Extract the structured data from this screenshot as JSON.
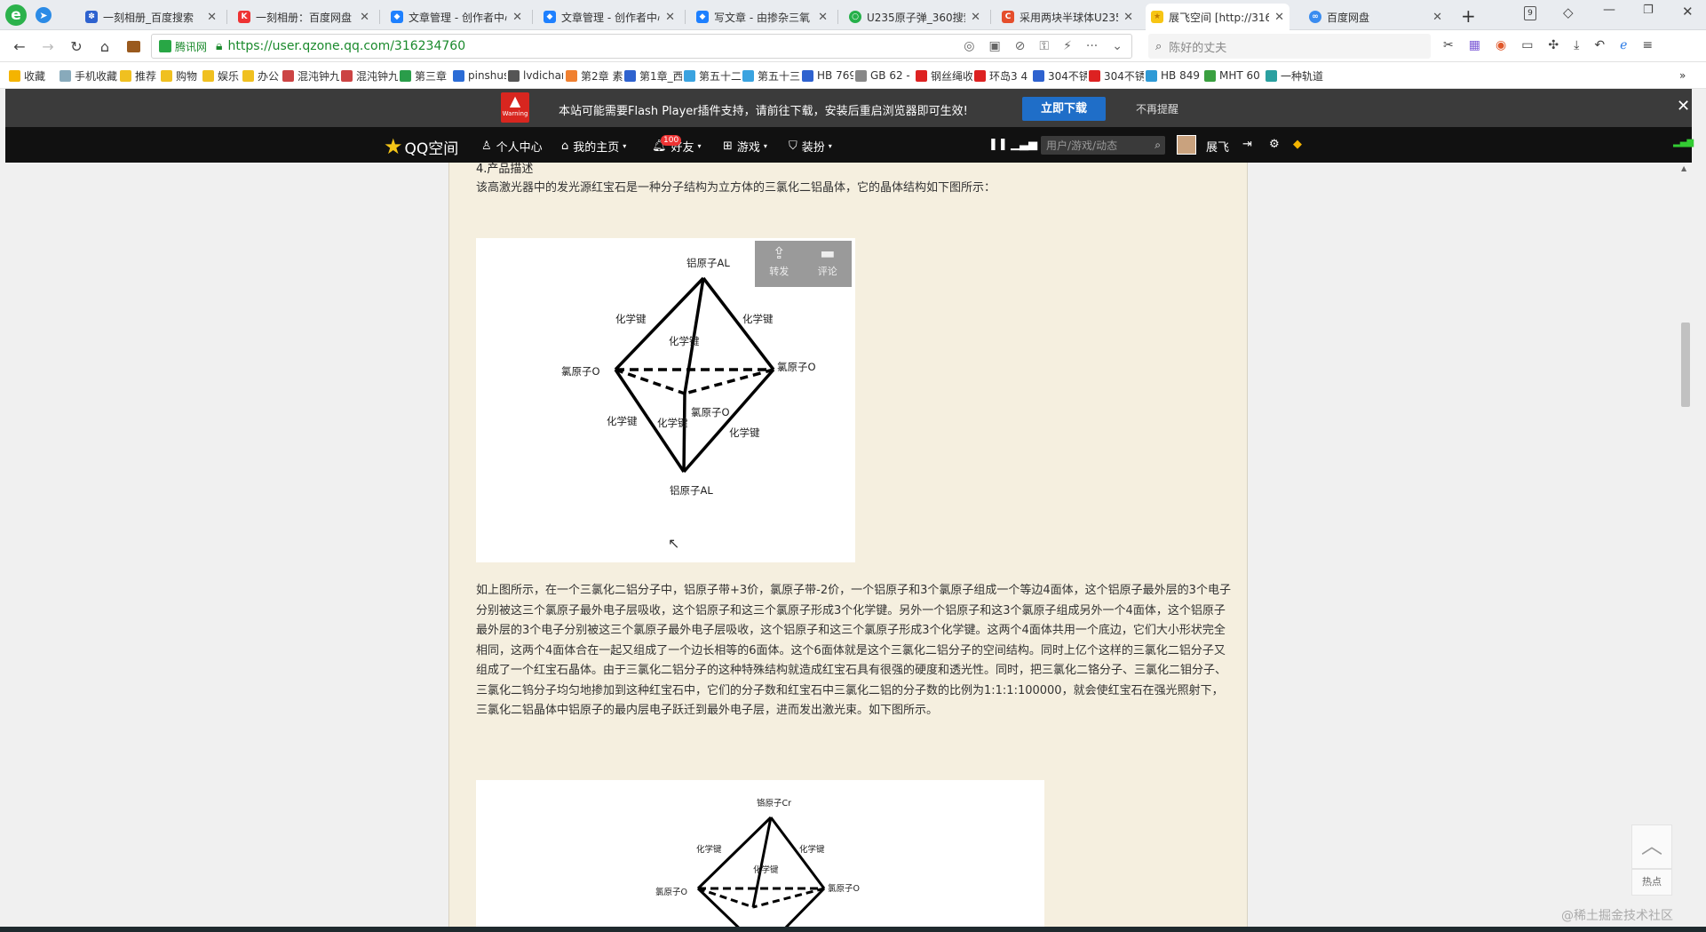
{
  "browser": {
    "tabs": [
      {
        "title": "一刻相册_百度搜索"
      },
      {
        "title": "一刻相册：百度网盘"
      },
      {
        "title": "文章管理 - 创作者中心"
      },
      {
        "title": "文章管理 - 创作者中心"
      },
      {
        "title": "写文章 - 由掺杂三氧"
      },
      {
        "title": "U235原子弹_360搜索"
      },
      {
        "title": "采用两块半球体U235"
      },
      {
        "title": "展飞空间 [http://316"
      },
      {
        "title": "百度网盘"
      }
    ],
    "tab_count": "9",
    "address": {
      "security_label": "腾讯网",
      "url": "https://user.qzone.qq.com/316234760"
    },
    "search_placeholder": "陈好的丈夫",
    "bookmarks": [
      {
        "label": "收藏"
      },
      {
        "label": "手机收藏夹"
      },
      {
        "label": "推荐"
      },
      {
        "label": "购物"
      },
      {
        "label": "娱乐"
      },
      {
        "label": "办公"
      },
      {
        "label": "混沌钟九"
      },
      {
        "label": "混沌钟九"
      },
      {
        "label": "第三章"
      },
      {
        "label": "pinshus"
      },
      {
        "label": "lvdichar"
      },
      {
        "label": "第2章 素"
      },
      {
        "label": "第1章_西"
      },
      {
        "label": "第五十二"
      },
      {
        "label": "第五十三"
      },
      {
        "label": "HB 769"
      },
      {
        "label": "GB 62 -"
      },
      {
        "label": "钢丝绳收"
      },
      {
        "label": "环岛3 4"
      },
      {
        "label": "304不锈"
      },
      {
        "label": "304不锈"
      },
      {
        "label": "HB 849"
      },
      {
        "label": "MHT 60"
      },
      {
        "label": "一种轨道"
      }
    ]
  },
  "flash_notice": {
    "warning_label": "Warning",
    "message": "本站可能需要Flash Player插件支持，请前往下载，安装后重启浏览器即可生效!",
    "download_button": "立即下载",
    "dismiss_link": "不再提醒"
  },
  "qzone_nav": {
    "logo_text": "QQ空间",
    "items": [
      {
        "label": "个人中心"
      },
      {
        "label": "我的主页"
      },
      {
        "label": "好友"
      },
      {
        "label": "游戏"
      },
      {
        "label": "装扮"
      }
    ],
    "friend_badge": "100",
    "search_placeholder": "用户/游戏/动态",
    "user_name": "展飞"
  },
  "article": {
    "section_heading": "4.产品描述",
    "intro": "该高激光器中的发光源红宝石是一种分子结构为立方体的三氯化二铝晶体，它的晶体结构如下图所示：",
    "image_actions": {
      "share": "转发",
      "comment": "评论"
    },
    "diagram1": {
      "top_atom": "铝原子AL",
      "bottom_atom": "铝原子AL",
      "left_atom": "氯原子O",
      "right_atom": "氯原子O",
      "middle_atom": "氯原子O",
      "bond_labels": [
        "化学键",
        "化学键",
        "化学键",
        "化学键",
        "化学键",
        "化学键"
      ]
    },
    "body": "如上图所示，在一个三氯化二铝分子中，铝原子带+3价，氯原子带-2价，一个铝原子和3个氯原子组成一个等边4面体，这个铝原子最外层的3个电子分别被这三个氯原子最外电子层吸收，这个铝原子和这三个氯原子形成3个化学键。另外一个铝原子和这3个氯原子组成另外一个4面体，这个铝原子最外层的3个电子分别被这三个氯原子最外电子层吸收，这个铝原子和这三个氯原子形成3个化学键。这两个4面体共用一个底边，它们大小形状完全相同，这两个4面体合在一起又组成了一个边长相等的6面体。这个6面体就是这个三氯化二铝分子的空间结构。同时上亿个这样的三氯化二铝分子又组成了一个红宝石晶体。由于三氯化二铝分子的这种特殊结构就造成红宝石具有很强的硬度和透光性。同时，把三氯化二铬分子、三氯化二钼分子、三氯化二钨分子均匀地掺加到这种红宝石中，它们的分子数和红宝石中三氯化二铝的分子数的比例为1:1:1:100000，就会使红宝石在强光照射下，三氯化二铝晶体中铝原子的最内层电子跃迁到最外电子层，进而发出激光束。如下图所示。",
    "diagram2": {
      "top_atom": "铬原子Cr",
      "left_atom": "氯原子O",
      "right_atom": "氯原子O",
      "bond_labels": [
        "化学键",
        "化学键",
        "化学键"
      ]
    }
  },
  "sidebar_right": {
    "hot_label": "热点"
  },
  "watermark": "@稀土掘金技术社区"
}
